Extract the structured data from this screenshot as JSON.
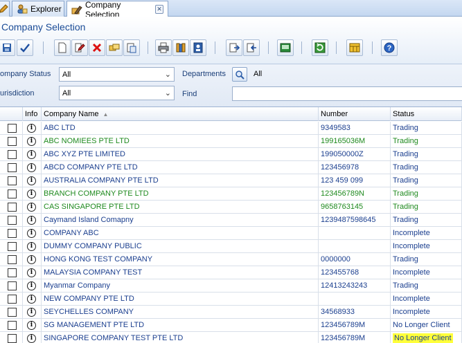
{
  "tabs": [
    {
      "label": "Explorer",
      "icon": "explorer-icon"
    },
    {
      "label": "Company Selection",
      "icon": "company-selection-icon",
      "active": true
    }
  ],
  "page": {
    "title": "Company Selection"
  },
  "toolbar": {
    "buttons": [
      "save-icon",
      "confirm-check-icon",
      "new-document-icon",
      "edit-document-icon",
      "delete-icon",
      "copy-icon",
      "paste-icon",
      "print-icon",
      "books-icon",
      "contact-card-icon",
      "export-icon",
      "import-icon",
      "screen-icon",
      "refresh-icon",
      "grid-layout-icon",
      "help-icon"
    ]
  },
  "filters": {
    "company_status_label": "ompany Status",
    "company_status_value": "All",
    "jurisdiction_label": "urisdiction",
    "jurisdiction_value": "All",
    "departments_label": "Departments",
    "departments_value": "All",
    "find_label": "Find",
    "find_value": ""
  },
  "grid": {
    "columns": {
      "info": "Info",
      "company_name": "Company Name",
      "number": "Number",
      "status": "Status"
    },
    "rows": [
      {
        "name": "ABC LTD",
        "number": "9349583",
        "status": "Trading",
        "color": "blue"
      },
      {
        "name": "ABC NOMIEES PTE LTD",
        "number": "199165036M",
        "status": "Trading",
        "color": "green"
      },
      {
        "name": "ABC XYZ PTE LIMITED",
        "number": "199050000Z",
        "status": "Trading",
        "color": "blue"
      },
      {
        "name": "ABCD COMPANY PTE LTD",
        "number": "123456978",
        "status": "Trading",
        "color": "blue"
      },
      {
        "name": "AUSTRALIA COMPANY PTE LTD",
        "number": "123 459 099",
        "status": "Trading",
        "color": "blue"
      },
      {
        "name": "BRANCH COMPANY PTE LTD",
        "number": "123456789N",
        "status": "Trading",
        "color": "green"
      },
      {
        "name": "CAS SINGAPORE PTE LTD",
        "number": "9658763145",
        "status": "Trading",
        "color": "green"
      },
      {
        "name": "Caymand Island Comapny",
        "number": "1239487598645",
        "status": "Trading",
        "color": "blue"
      },
      {
        "name": "COMPANY ABC",
        "number": "",
        "status": "Incomplete",
        "color": "blue"
      },
      {
        "name": "DUMMY COMPANY PUBLIC",
        "number": "",
        "status": "Incomplete",
        "color": "blue"
      },
      {
        "name": "HONG KONG TEST COMPANY",
        "number": "0000000",
        "status": "Trading",
        "color": "blue"
      },
      {
        "name": "MALAYSIA COMPANY TEST",
        "number": "123455768",
        "status": "Incomplete",
        "color": "blue"
      },
      {
        "name": "Myanmar Company",
        "number": "12413243243",
        "status": "Trading",
        "color": "blue"
      },
      {
        "name": "NEW COMPANY PTE LTD",
        "number": "",
        "status": "Incomplete",
        "color": "blue"
      },
      {
        "name": "SEYCHELLES COMPANY",
        "number": "34568933",
        "status": "Incomplete",
        "color": "blue"
      },
      {
        "name": "SG MANAGEMENT PTE LTD",
        "number": "123456789M",
        "status": "No Longer Client",
        "color": "blue"
      },
      {
        "name": "SINGAPORE COMPANY TEST PTE LTD",
        "number": "123456789M",
        "status": "No Longer Client",
        "color": "blue",
        "highlight_status": true
      }
    ]
  },
  "colors": {
    "green": "#1f8a1f",
    "blue": "#1b3f8f",
    "highlight": "#ffff3a",
    "title": "#1a4b96"
  }
}
